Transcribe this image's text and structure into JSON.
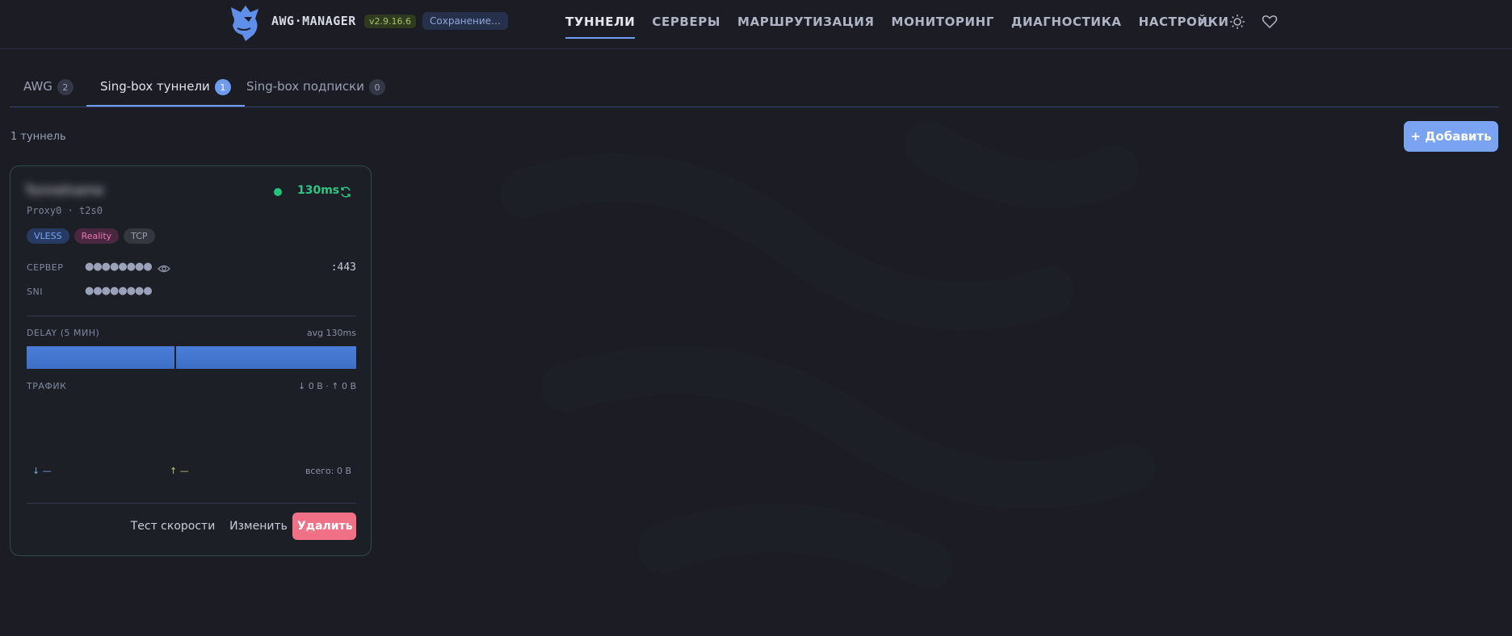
{
  "header": {
    "brand": "AWG·MANAGER",
    "version": "v2.9.16.6",
    "saving": "Сохранение…",
    "nav": [
      "ТУННЕЛИ",
      "СЕРВЕРЫ",
      "МАРШРУТИЗАЦИЯ",
      "МОНИТОРИНГ",
      "ДИАГНОСТИКА",
      "НАСТРОЙКИ"
    ],
    "active_nav": "ТУННЕЛИ",
    "icons": [
      "terminal-icon",
      "sun-icon",
      "heart-icon"
    ]
  },
  "tabs": [
    {
      "label": "AWG",
      "count": "2"
    },
    {
      "label": "Sing-box туннели",
      "count": "1"
    },
    {
      "label": "Sing-box подписки",
      "count": "0"
    }
  ],
  "active_tab": "Sing-box туннели",
  "tunnel_count": "1 туннель",
  "add_label": "+ Добавить",
  "card": {
    "name": "Tunnelname",
    "subtitle": "Proxy0 · t2s0",
    "latency": "130ms",
    "status_color": "#22c57a",
    "tags": [
      "VLESS",
      "Reality",
      "TCP"
    ],
    "server_label": "СЕРВЕР",
    "server_value": "●●●●●●●●",
    "port": ":443",
    "sni_label": "SNI",
    "sni_value": "●●●●●●●●",
    "delay_label": "DELAY (5 МИН)",
    "delay_avg": "avg 130ms",
    "traffic_label": "ТРАФИК",
    "traffic_summary": "↓ 0 B · ↑ 0 B",
    "down": "↓ —",
    "up": "↑ —",
    "total": "всего: 0 B",
    "buttons": {
      "speed_test": "Тест скорости",
      "edit": "Изменить",
      "delete": "Удалить"
    }
  },
  "colors": {
    "accent": "#6f9cf0",
    "danger": "#f07185",
    "success": "#22c57a"
  }
}
